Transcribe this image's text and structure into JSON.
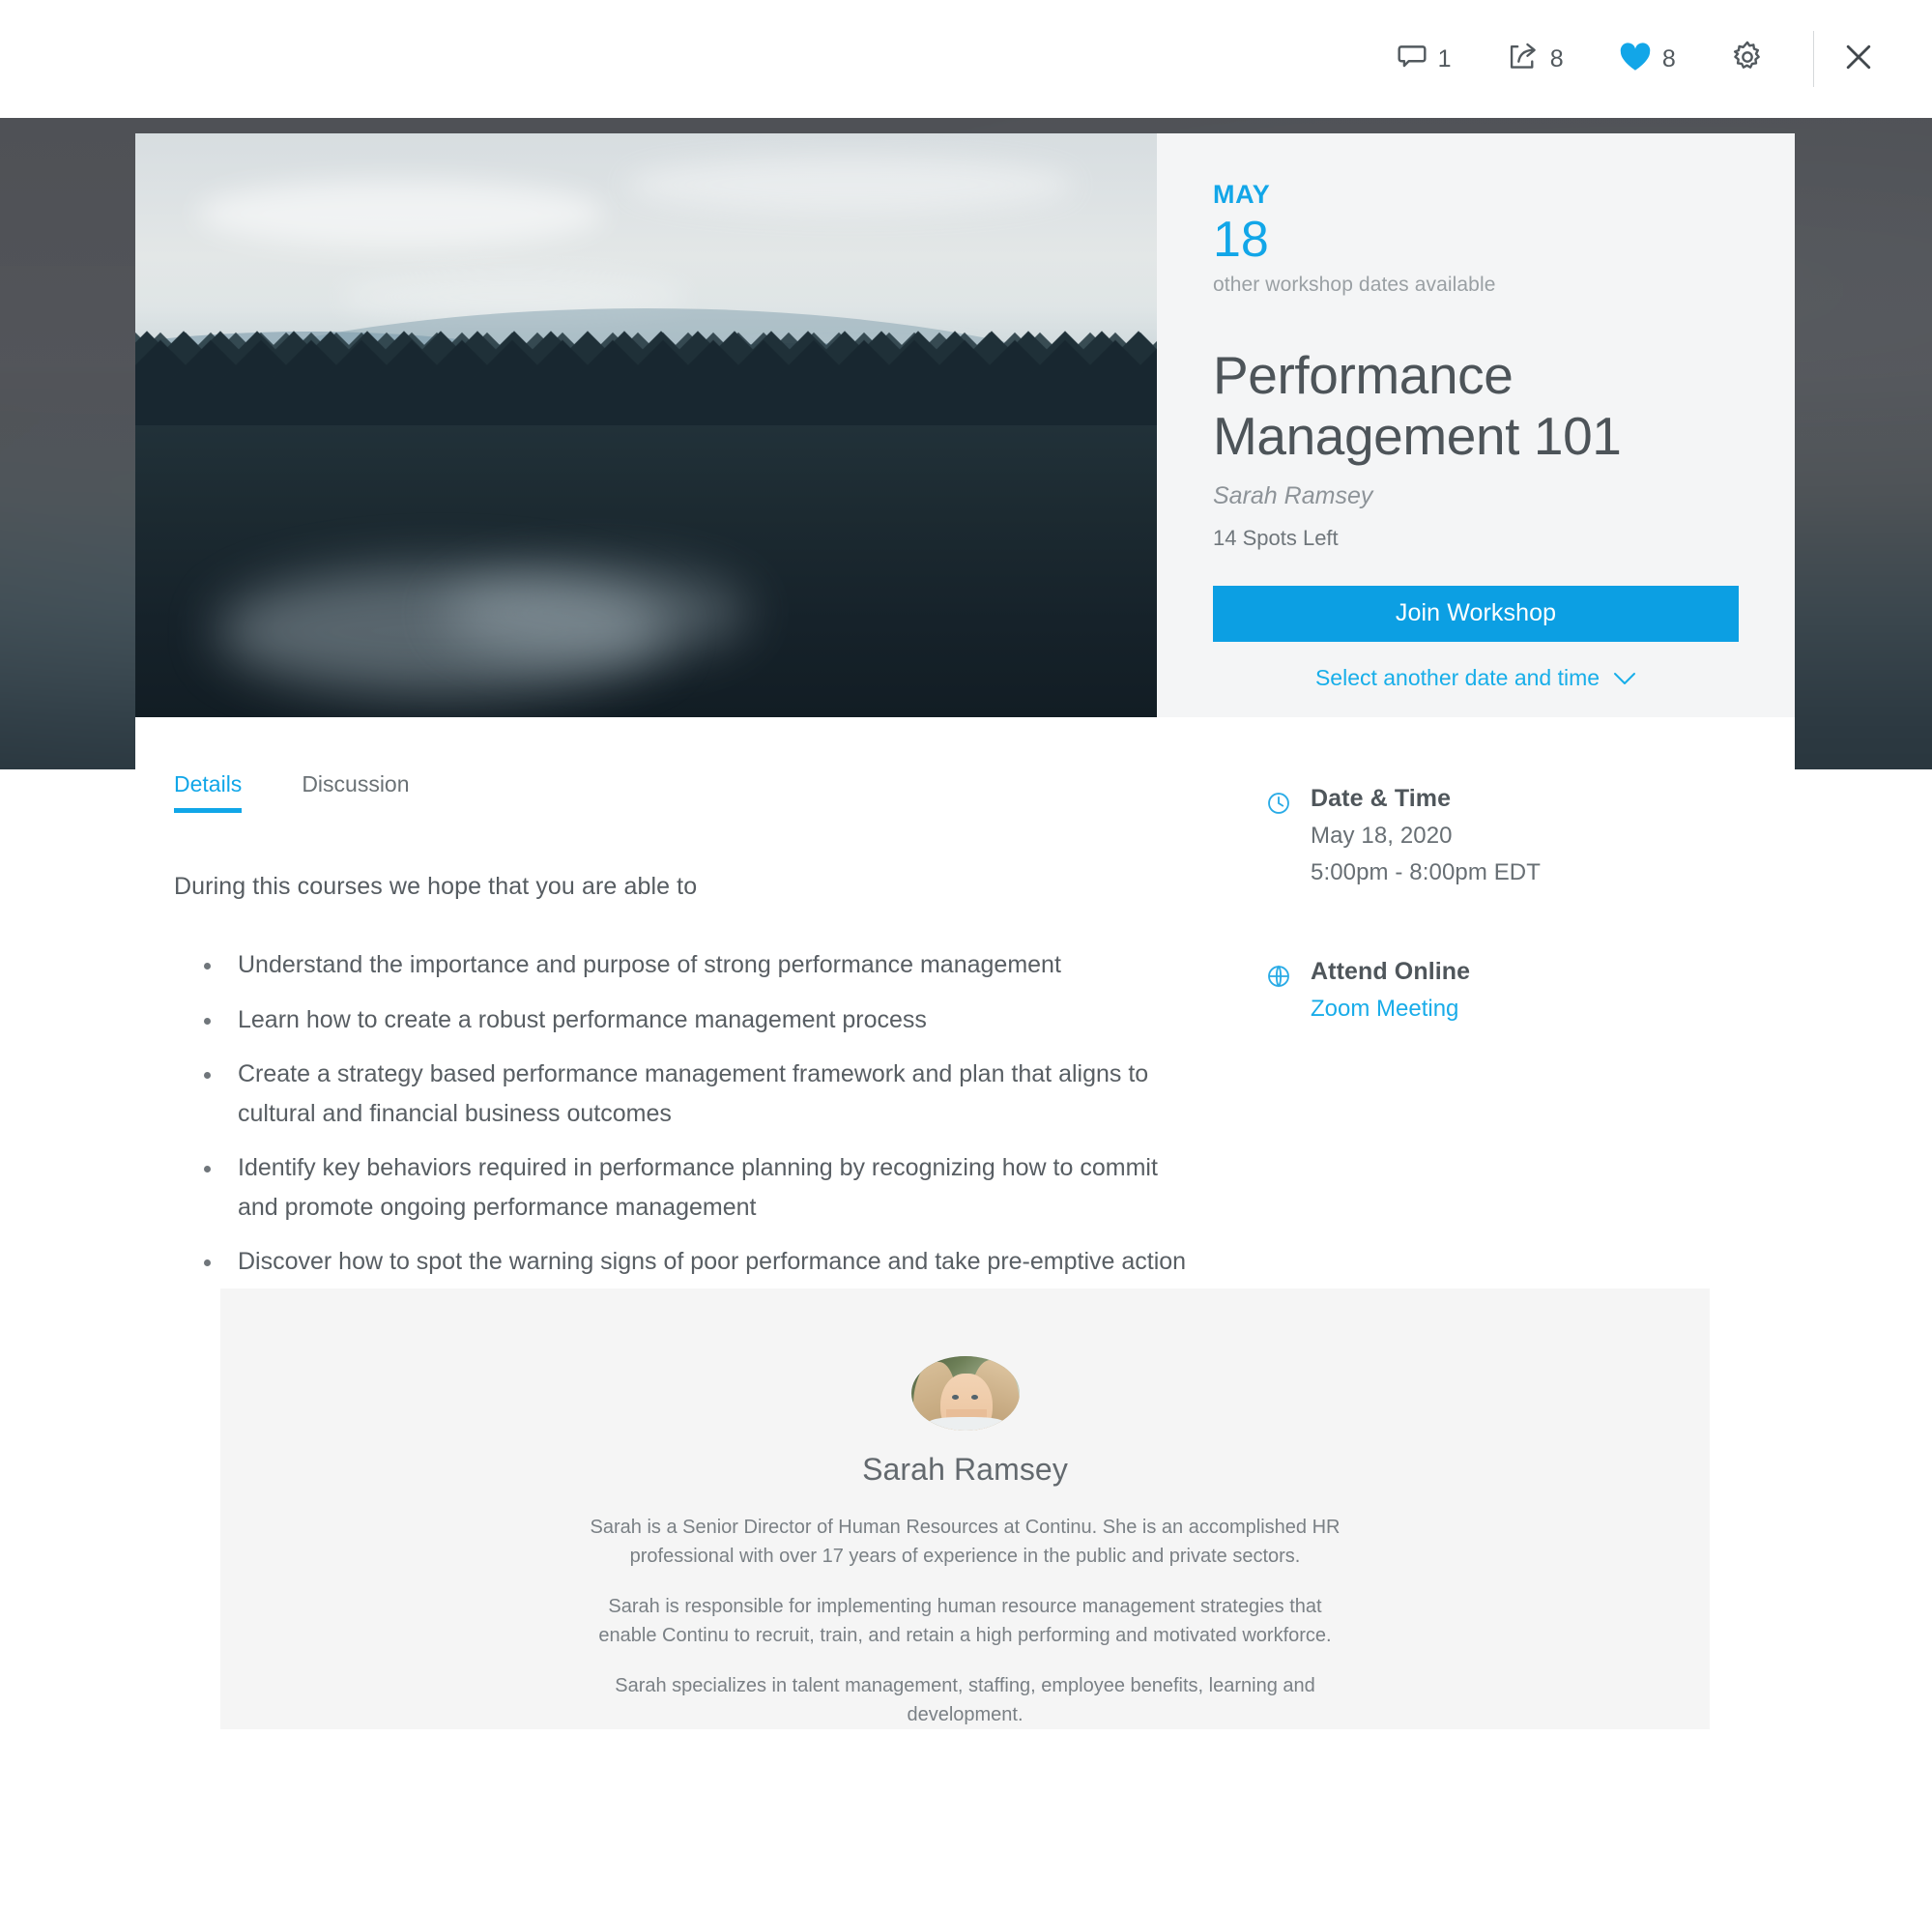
{
  "topbar": {
    "actions": [
      {
        "icon": "comment-icon",
        "count": "1"
      },
      {
        "icon": "share-icon",
        "count": "8"
      },
      {
        "icon": "heart-icon",
        "count": "8"
      }
    ],
    "settings_icon": "gear-icon",
    "close_icon": "close-icon",
    "accent": "#0c9fe3",
    "heart_color": "#12a6e8"
  },
  "hero": {
    "month": "MAY",
    "day": "18",
    "other_dates_note": "other workshop dates available",
    "title": "Performance Management 101",
    "instructor": "Sarah Ramsey",
    "spots": "14 Spots Left",
    "join_label": "Join Workshop",
    "select_date_label": "Select another date and time",
    "chevron_icon": "chevron-down-icon",
    "image_alt": "misty forest and mountain landscape"
  },
  "tabs": [
    {
      "label": "Details",
      "active": true
    },
    {
      "label": "Discussion",
      "active": false
    }
  ],
  "details": {
    "intro": "During this courses we hope that you are able to",
    "bullets": [
      "Understand the importance and purpose of strong performance management",
      "Learn how to create a robust performance management process",
      "Create a strategy based performance management framework and plan that aligns to cultural and financial business outcomes",
      "Identify key behaviors required in performance planning by recognizing how to commit and promote ongoing performance management",
      "Discover how to spot the warning signs of poor performance and take pre-emptive action"
    ]
  },
  "sidebar": {
    "datetime": {
      "icon": "clock-icon",
      "title": "Date & Time",
      "date": "May 18, 2020",
      "time": "5:00pm - 8:00pm EDT"
    },
    "online": {
      "icon": "globe-icon",
      "title": "Attend Online",
      "link_label": "Zoom Meeting"
    }
  },
  "instructor_panel": {
    "avatar_name": "instructor-avatar",
    "name": "Sarah Ramsey",
    "bio": [
      "Sarah is a Senior Director of Human Resources at Continu. She is an accomplished HR professional with over 17 years of experience in the public and private sectors.",
      "Sarah is responsible for implementing human resource management strategies that enable Continu to recruit, train, and retain a high performing and motivated workforce.",
      "Sarah specializes in talent management, staffing, employee benefits, learning and development."
    ]
  }
}
